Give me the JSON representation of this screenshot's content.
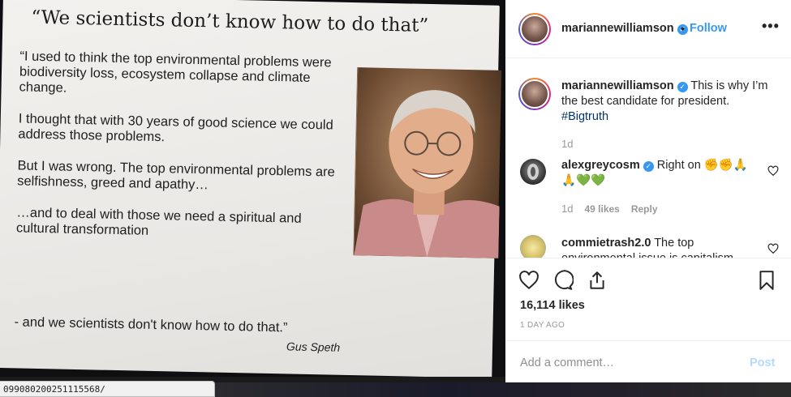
{
  "slide": {
    "title": "“We scientists don’t know how to do that”",
    "paragraphs": [
      "“I used to think the top environmental problems were biodiversity loss, ecosystem collapse and climate change.",
      "I thought that with 30 years of good science we could address those problems.",
      "But I was wrong. The top environmental problems are selfishness, greed and apathy…",
      "…and to deal with those we need a spiritual and cultural transformation"
    ],
    "closing": "- and we scientists don't know how to do that.”",
    "author": "Gus Speth"
  },
  "status_url": "099080200251115568/",
  "post": {
    "username": "mariannewilliamson",
    "follow_separator": "•",
    "follow_label": "Follow",
    "more_label": "•••",
    "caption": {
      "username": "mariannewilliamson",
      "text": "This is why I’m the best candidate for president.",
      "hashtag": "#Bigtruth",
      "time": "1d"
    },
    "comments": [
      {
        "username": "alexgreycosm",
        "text": "Right on ✊✊🙏",
        "text2": "🙏💚💚",
        "time": "1d",
        "likes": "49 likes",
        "reply": "Reply"
      },
      {
        "username": "commietrash2.0",
        "text": "The top environmental issue is capitalism"
      }
    ],
    "likes": "16,114 likes",
    "posted": "1 DAY AGO",
    "comment_placeholder": "Add a comment…",
    "post_label": "Post"
  },
  "colors": {
    "accent": "#3897f0",
    "hashtag": "#003569",
    "post_disabled": "#b3dbff"
  },
  "icons": [
    "heart-icon",
    "comment-icon",
    "share-icon",
    "bookmark-icon",
    "verified-icon"
  ]
}
